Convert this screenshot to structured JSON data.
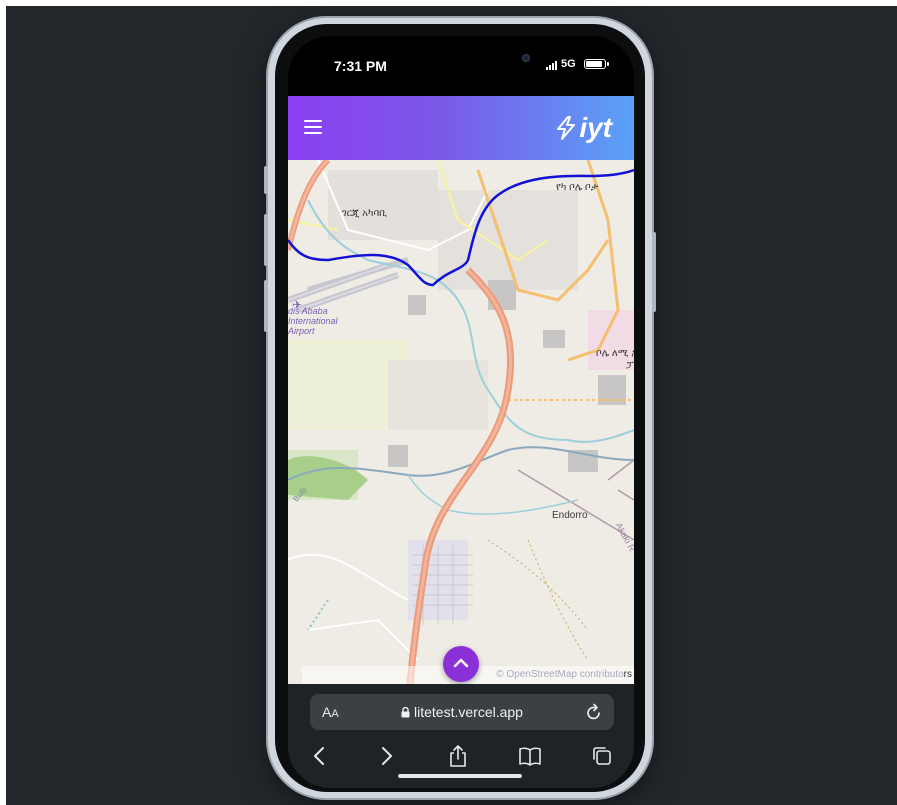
{
  "status_bar": {
    "time": "7:31 PM",
    "network": "5G",
    "signal_icon": "signal-bars-icon",
    "battery_icon": "battery-icon"
  },
  "app": {
    "logo_text": "iyt",
    "logo_icon": "lightning-bolt-icon",
    "menu_icon": "hamburger-menu-icon",
    "header_gradient": [
      "#8b3ff0",
      "#5aa2f8"
    ]
  },
  "map": {
    "labels": {
      "gerji": "ገርጂ አካባቢ",
      "yeka_bole": "የካ ቦሌ ቦታ",
      "bole_lemi": "ቦሌ ለሚ ኢ",
      "bole_lemi_2": "ፓ",
      "airport": [
        "dis Ababa",
        "International",
        "Airport"
      ],
      "endorro": "Endorro",
      "akaki": "Akaki R",
      "river": "Bulb"
    },
    "attribution_link": "© OpenStreetMap contributo",
    "attribution_tail": "rs",
    "route_color": "#1212d6",
    "highway_color": "#ec9a7a"
  },
  "fab": {
    "icon": "chevron-up-icon",
    "color": "#8b2fd9"
  },
  "browser": {
    "aa_large": "A",
    "aa_small": "A",
    "url": "litetest.vercel.app",
    "lock_icon": "lock-icon",
    "reload_icon": "reload-icon",
    "toolbar": {
      "back_icon": "chevron-left-icon",
      "forward_icon": "chevron-right-icon",
      "share_icon": "share-icon",
      "bookmarks_icon": "book-icon",
      "tabs_icon": "tabs-icon"
    }
  }
}
